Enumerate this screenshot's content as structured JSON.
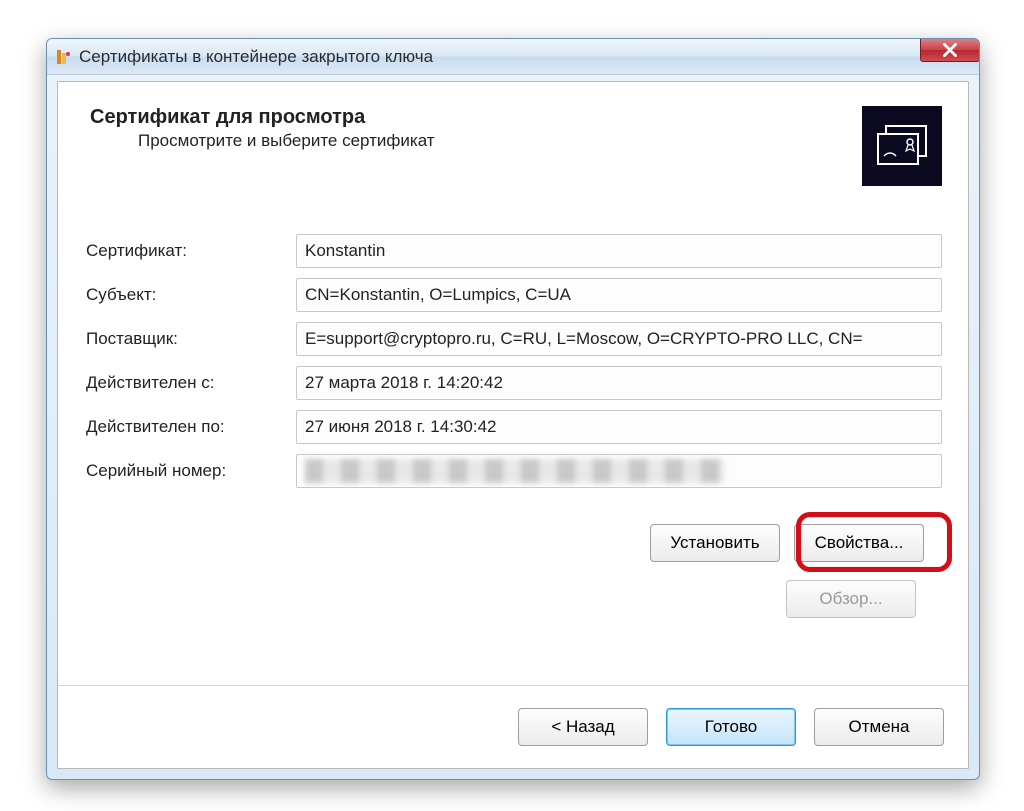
{
  "window": {
    "title": "Сертификаты в контейнере закрытого ключа"
  },
  "header": {
    "title": "Сертификат для просмотра",
    "subtitle": "Просмотрите и выберите сертификат"
  },
  "fields": {
    "certificate_label": "Сертификат:",
    "certificate_value": "Konstantin",
    "subject_label": "Субъект:",
    "subject_value": "CN=Konstantin, O=Lumpics, C=UA",
    "issuer_label": "Поставщик:",
    "issuer_value": "E=support@cryptopro.ru, C=RU, L=Moscow, O=CRYPTO-PRO LLC, CN=",
    "valid_from_label": "Действителен с:",
    "valid_from_value": "27 марта 2018 г. 14:20:42",
    "valid_to_label": "Действителен по:",
    "valid_to_value": "27 июня 2018 г. 14:30:42",
    "serial_label": "Серийный номер:",
    "serial_value": ""
  },
  "buttons": {
    "install": "Установить",
    "properties": "Свойства...",
    "browse": "Обзор...",
    "back": "< Назад",
    "finish": "Готово",
    "cancel": "Отмена"
  }
}
